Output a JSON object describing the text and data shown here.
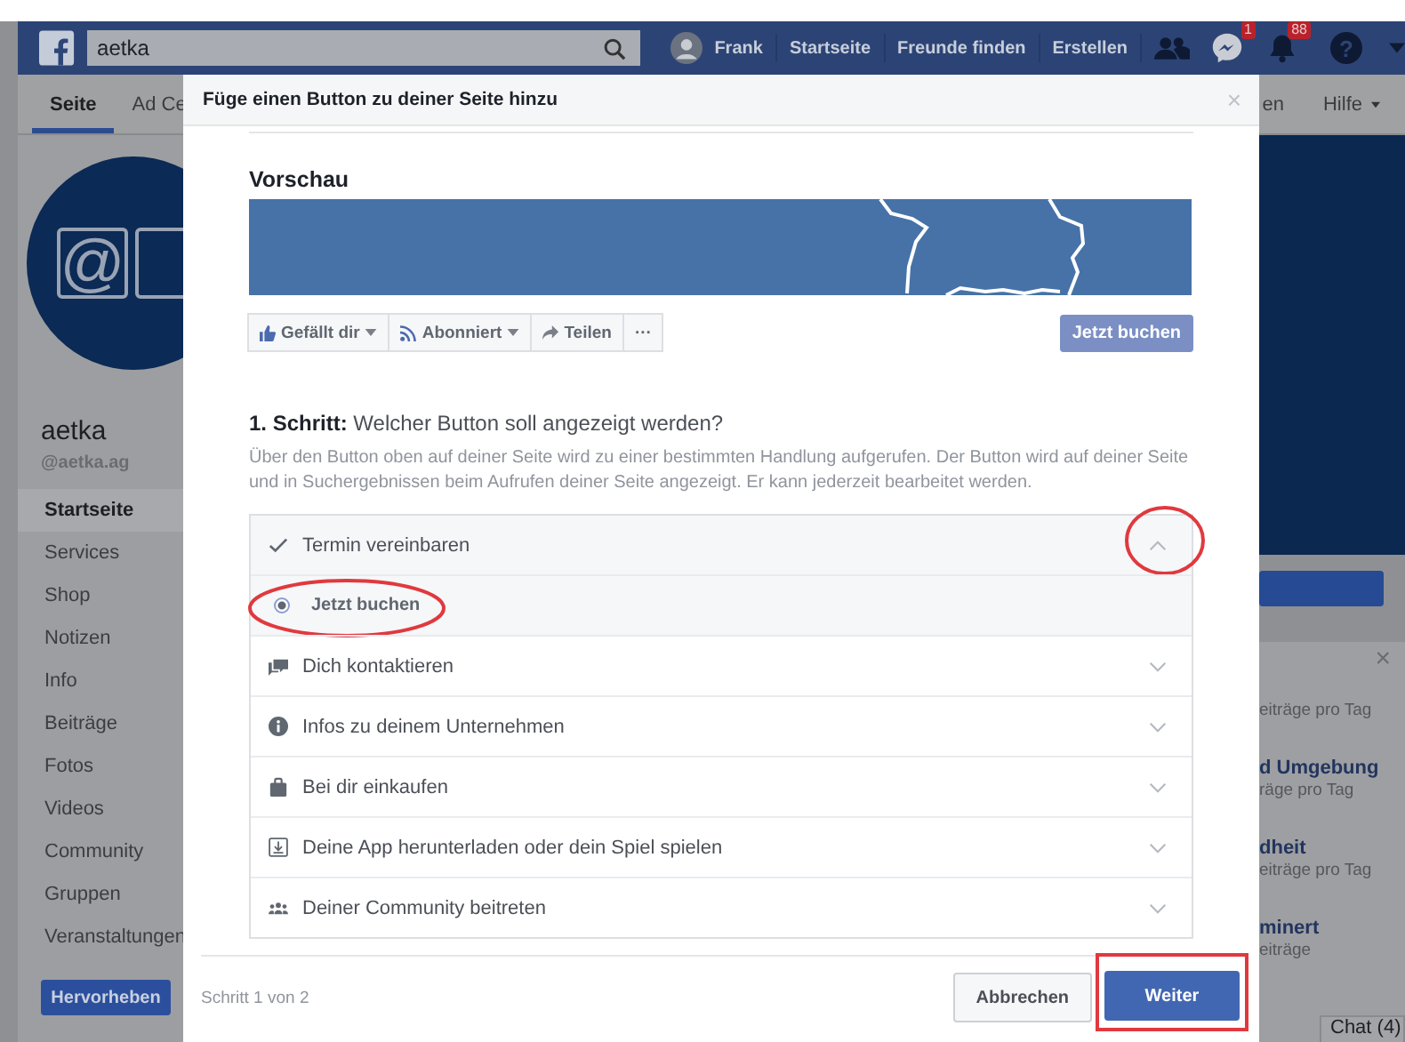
{
  "top_bar": {
    "search_value": "aetka",
    "user": "Frank",
    "nav": [
      "Startseite",
      "Freunde finden",
      "Erstellen"
    ],
    "message_badge": "1",
    "notification_badge": "88",
    "help": "?"
  },
  "page_tabs": [
    {
      "label": "Seite",
      "selected": true
    },
    {
      "label": "Ad Ce",
      "selected": false
    }
  ],
  "right_tabs": [
    "en",
    "Hilfe"
  ],
  "profile": {
    "logo": "@",
    "name": "aetka",
    "handle": "@aetka.ag"
  },
  "sidebar": {
    "items": [
      {
        "label": "Startseite",
        "selected": true
      },
      {
        "label": "Services",
        "selected": false
      },
      {
        "label": "Shop",
        "selected": false
      },
      {
        "label": "Notizen",
        "selected": false
      },
      {
        "label": "Info",
        "selected": false
      },
      {
        "label": "Beiträge",
        "selected": false
      },
      {
        "label": "Fotos",
        "selected": false
      },
      {
        "label": "Videos",
        "selected": false
      },
      {
        "label": "Community",
        "selected": false
      },
      {
        "label": "Gruppen",
        "selected": false
      },
      {
        "label": "Veranstaltungen",
        "selected": false
      }
    ],
    "promote_button": "Hervorheben"
  },
  "right_column": {
    "close": "×",
    "suggestions": [
      {
        "subtitle": "eiträge pro Tag"
      },
      {
        "title": "d Umgebung",
        "subtitle": "räge pro Tag"
      },
      {
        "title": "dheit",
        "subtitle": "eiträge pro Tag"
      },
      {
        "title": "minert",
        "subtitle": "eiträge"
      }
    ]
  },
  "chat": "Chat (4)",
  "modal": {
    "title": "Füge einen Button zu deiner Seite hinzu",
    "close": "×",
    "preview_heading": "Vorschau",
    "preview_actions": [
      "Gefällt dir",
      "Abonniert",
      "Teilen",
      "···"
    ],
    "preview_button": "Jetzt buchen",
    "step_heading": "**1. Schritt:** Welcher Button soll angezeigt werden?",
    "step_description": "Über den Button oben auf deiner Seite wird zu einer bestimmten Handlung aufgerufen. Der Button wird auf deiner Seite und in Suchergebnissen beim Aufrufen deiner Seite angezeigt. Er kann jederzeit bearbeitet werden.",
    "options": [
      {
        "label": "Termin vereinbaren",
        "expanded": true,
        "children": [
          {
            "label": "Jetzt buchen",
            "selected": true
          }
        ]
      },
      {
        "label": "Dich kontaktieren",
        "expanded": false
      },
      {
        "label": "Infos zu deinem Unternehmen",
        "expanded": false
      },
      {
        "label": "Bei dir einkaufen",
        "expanded": false
      },
      {
        "label": "Deine App herunterladen oder dein Spiel spielen",
        "expanded": false
      },
      {
        "label": "Deiner Community beitreten",
        "expanded": false
      }
    ],
    "step_counter": "Schritt 1 von 2",
    "buttons": [
      {
        "label": "Abbrechen",
        "kind": "secondary"
      },
      {
        "label": "Weiter",
        "kind": "primary"
      }
    ]
  }
}
